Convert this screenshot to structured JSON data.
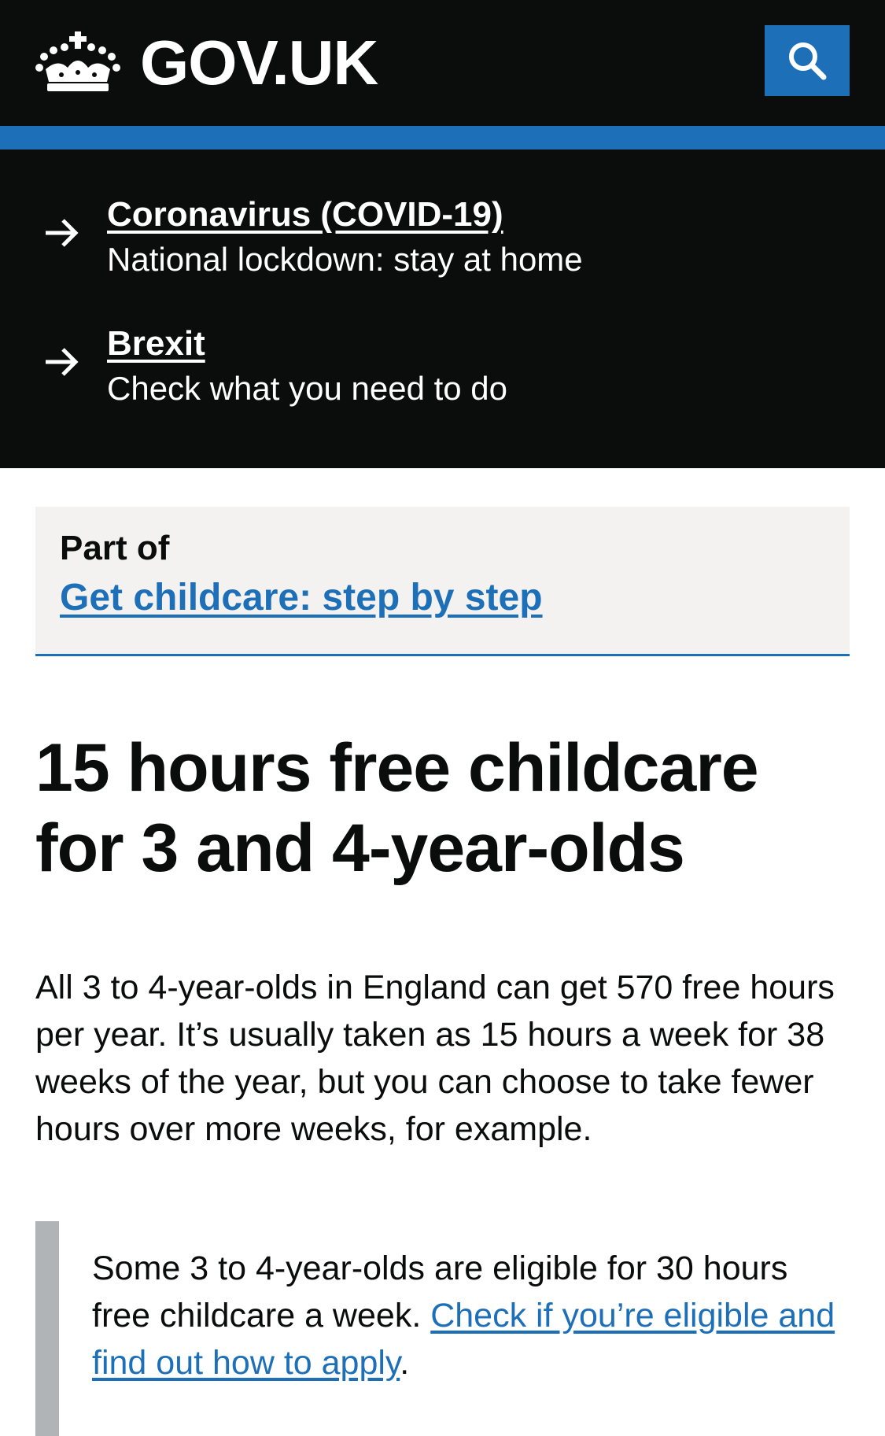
{
  "header": {
    "logo_text": "GOV.UK",
    "search_label": "Search"
  },
  "emergency": {
    "items": [
      {
        "title": "Coronavirus (COVID-19)",
        "description": "National lockdown: stay at home"
      },
      {
        "title": "Brexit",
        "description": "Check what you need to do"
      }
    ]
  },
  "part_of": {
    "label": "Part of",
    "link_text": "Get childcare: step by step"
  },
  "main": {
    "title": "15 hours free childcare for 3 and 4-year-olds",
    "lead": "All 3 to 4-year-olds in England can get 570 free hours per year. It’s usually taken as 15 hours a week for 38 weeks of the year, but you can choose to take fewer hours over more weeks, for example.",
    "inset_text": "Some 3 to 4-year-olds are eligible for 30 hours free childcare a week. ",
    "inset_link": "Check if you’re eligible and find out how to apply",
    "inset_suffix": "."
  },
  "colors": {
    "header_bg": "#0b0c0c",
    "brand_blue": "#1d70b8",
    "panel_grey": "#f3f2f1",
    "inset_border": "#b1b4b6"
  }
}
